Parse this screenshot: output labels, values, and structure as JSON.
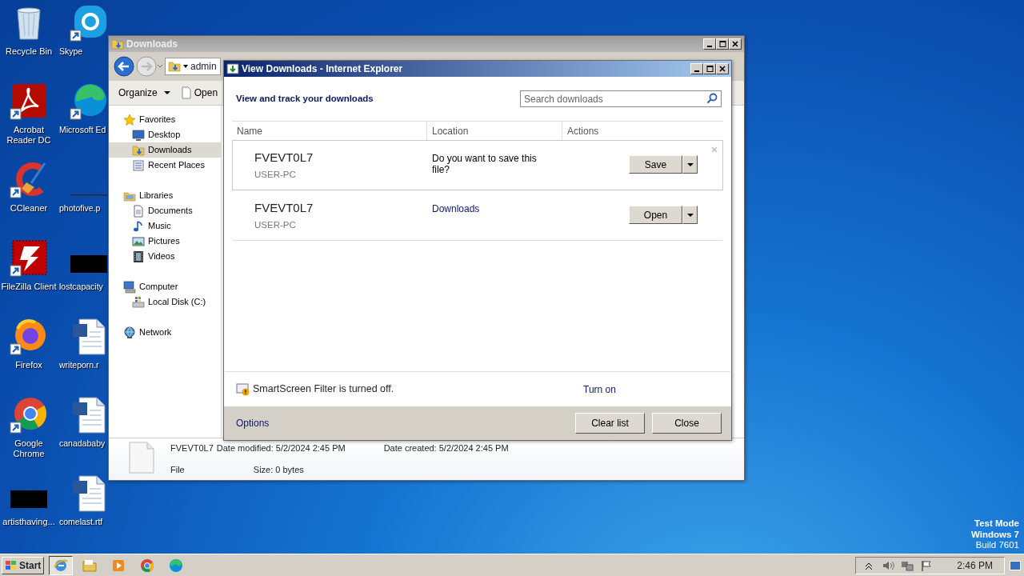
{
  "desktop_icons": [
    {
      "label": "Recycle Bin",
      "kind": "recycle"
    },
    {
      "label": "Skype",
      "kind": "skype"
    },
    {
      "label": "Acrobat Reader DC",
      "kind": "acrobat"
    },
    {
      "label": "Microsoft Ed",
      "kind": "edge"
    },
    {
      "label": "CCleaner",
      "kind": "ccleaner"
    },
    {
      "label": "photofive.p",
      "kind": "blank"
    },
    {
      "label": "FileZilla Client",
      "kind": "filezilla"
    },
    {
      "label": "lostcapacity",
      "kind": "black"
    },
    {
      "label": "Firefox",
      "kind": "firefox"
    },
    {
      "label": "writeporn.r",
      "kind": "word"
    },
    {
      "label": "Google Chrome",
      "kind": "chrome"
    },
    {
      "label": "canadababy",
      "kind": "word"
    },
    {
      "label": "artisthaving...",
      "kind": "black"
    },
    {
      "label": "comelast.rtf",
      "kind": "word"
    }
  ],
  "explorer": {
    "title": "Downloads",
    "address": "admin",
    "toolbar": [
      {
        "label": "Organize",
        "kind": "menu"
      },
      {
        "label": "Open",
        "kind": "open"
      }
    ],
    "nav": [
      {
        "label": "Favorites",
        "kind": "star",
        "selected": false,
        "children": [
          {
            "label": "Desktop",
            "kind": "desktop",
            "selected": false
          },
          {
            "label": "Downloads",
            "kind": "downloads",
            "selected": true
          },
          {
            "label": "Recent Places",
            "kind": "recent",
            "selected": false
          }
        ]
      },
      {
        "label": "Libraries",
        "kind": "library",
        "selected": false,
        "children": [
          {
            "label": "Documents",
            "kind": "documents",
            "selected": false
          },
          {
            "label": "Music",
            "kind": "music",
            "selected": false
          },
          {
            "label": "Pictures",
            "kind": "pictures",
            "selected": false
          },
          {
            "label": "Videos",
            "kind": "videos",
            "selected": false
          }
        ]
      },
      {
        "label": "Computer",
        "kind": "computer",
        "selected": false,
        "children": [
          {
            "label": "Local Disk (C:)",
            "kind": "disk",
            "selected": false
          }
        ]
      },
      {
        "label": "Network",
        "kind": "network",
        "selected": false
      }
    ],
    "details": {
      "name": "FVEVT0L7",
      "type": "File",
      "fields": [
        {
          "label": "Date modified:",
          "value": "5/2/2024 2:45 PM"
        },
        {
          "label": "Size:",
          "value": "0 bytes"
        },
        {
          "label": "Date created:",
          "value": "5/2/2024 2:45 PM"
        }
      ]
    }
  },
  "downloads_dialog": {
    "title": "View Downloads - Internet Explorer",
    "heading": "View and track your downloads",
    "search": {
      "placeholder": "Search downloads"
    },
    "columns": [
      "Name",
      "Location",
      "Actions"
    ],
    "rows": [
      {
        "name": "FVEVT0L7",
        "source": "USER-PC",
        "location": "Do you want to save this file?",
        "kind": "prompt",
        "action": "Save",
        "selected": true
      },
      {
        "name": "FVEVT0L7",
        "source": "USER-PC",
        "location": "Downloads",
        "kind": "link",
        "action": "Open",
        "selected": false
      }
    ],
    "smartscreen": {
      "message": "SmartScreen Filter is turned off.",
      "link": "Turn on"
    },
    "options_link": "Options",
    "buttons": [
      "Clear list",
      "Close"
    ]
  },
  "taskbar": {
    "start": "Start",
    "apps": [
      {
        "kind": "ie",
        "selected": true
      },
      {
        "kind": "folder",
        "selected": false
      },
      {
        "kind": "media",
        "selected": false
      },
      {
        "kind": "chrome",
        "selected": false
      },
      {
        "kind": "edge",
        "selected": false
      }
    ],
    "time": "2:46 PM"
  },
  "os_watermark": [
    "Test Mode",
    "Windows 7",
    "Build 7601"
  ]
}
